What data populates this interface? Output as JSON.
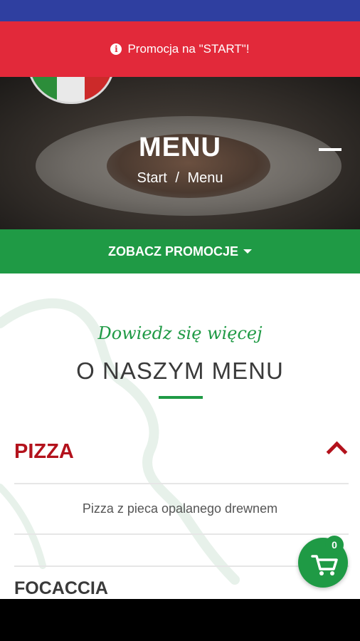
{
  "promo_banner": {
    "text": "Promocja na \"START\"!",
    "icon": "info-icon",
    "color": "#e2293a"
  },
  "header": {
    "title": "MENU",
    "breadcrumb": {
      "home": "Start",
      "separator": "/",
      "current": "Menu"
    }
  },
  "promo_toggle": {
    "label": "ZOBACZ PROMOCJE",
    "icon": "caret-down-icon",
    "color": "#1f9a45"
  },
  "section": {
    "eyebrow": "Dowiedz się więcej",
    "title": "O NASZYM MENU"
  },
  "categories": [
    {
      "name": "PIZZA",
      "description": "Pizza z pieca opalanego drewnem",
      "expanded": true
    },
    {
      "name": "FOCACCIA"
    }
  ],
  "cart": {
    "count": "0",
    "icon": "cart-icon"
  },
  "colors": {
    "accent_green": "#1f9a45",
    "accent_red": "#b3121c",
    "status_bar": "#2f3fa0"
  }
}
